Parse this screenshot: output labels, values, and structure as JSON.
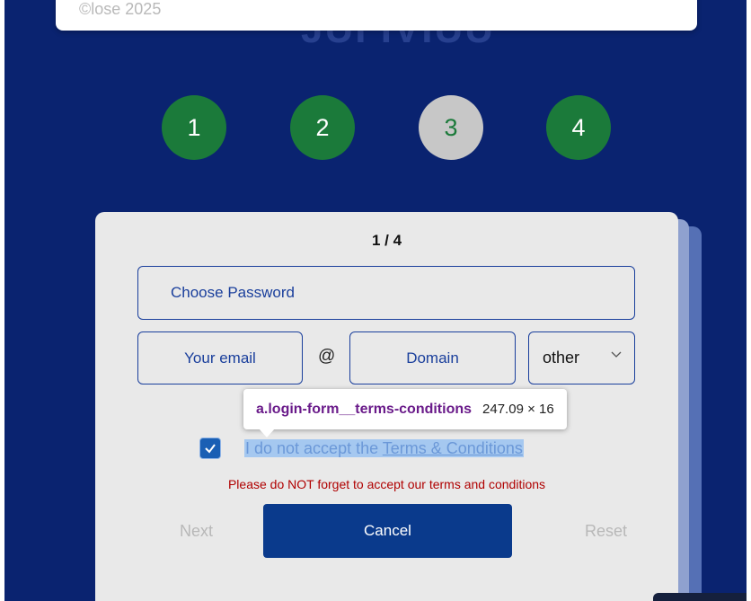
{
  "top_popup": {
    "text": "©lose 2025"
  },
  "page_title_partial": "JUI IVIUU",
  "steps": [
    "1",
    "2",
    "3",
    "4"
  ],
  "form": {
    "counter": "1 / 4",
    "password_placeholder": "Choose Password",
    "email_placeholder": "Your email",
    "at_sign": "@",
    "domain_placeholder": "Domain",
    "domain_select_value": "other",
    "terms_prefix": "I do not accept the ",
    "terms_link": "Terms & Conditions",
    "warning": "Please do NOT forget to accept our terms and conditions",
    "next_label": "Next",
    "cancel_label": "Cancel",
    "reset_label": "Reset"
  },
  "devtools_tooltip": {
    "selector": "a.login-form__terms-conditions",
    "dimensions": "247.09 × 16"
  },
  "colors": {
    "background": "#0a2370",
    "step_green": "#1b7a3a",
    "step_active": "#c7c7c7",
    "primary_button": "#0a3a8c",
    "warning": "#b00000"
  }
}
